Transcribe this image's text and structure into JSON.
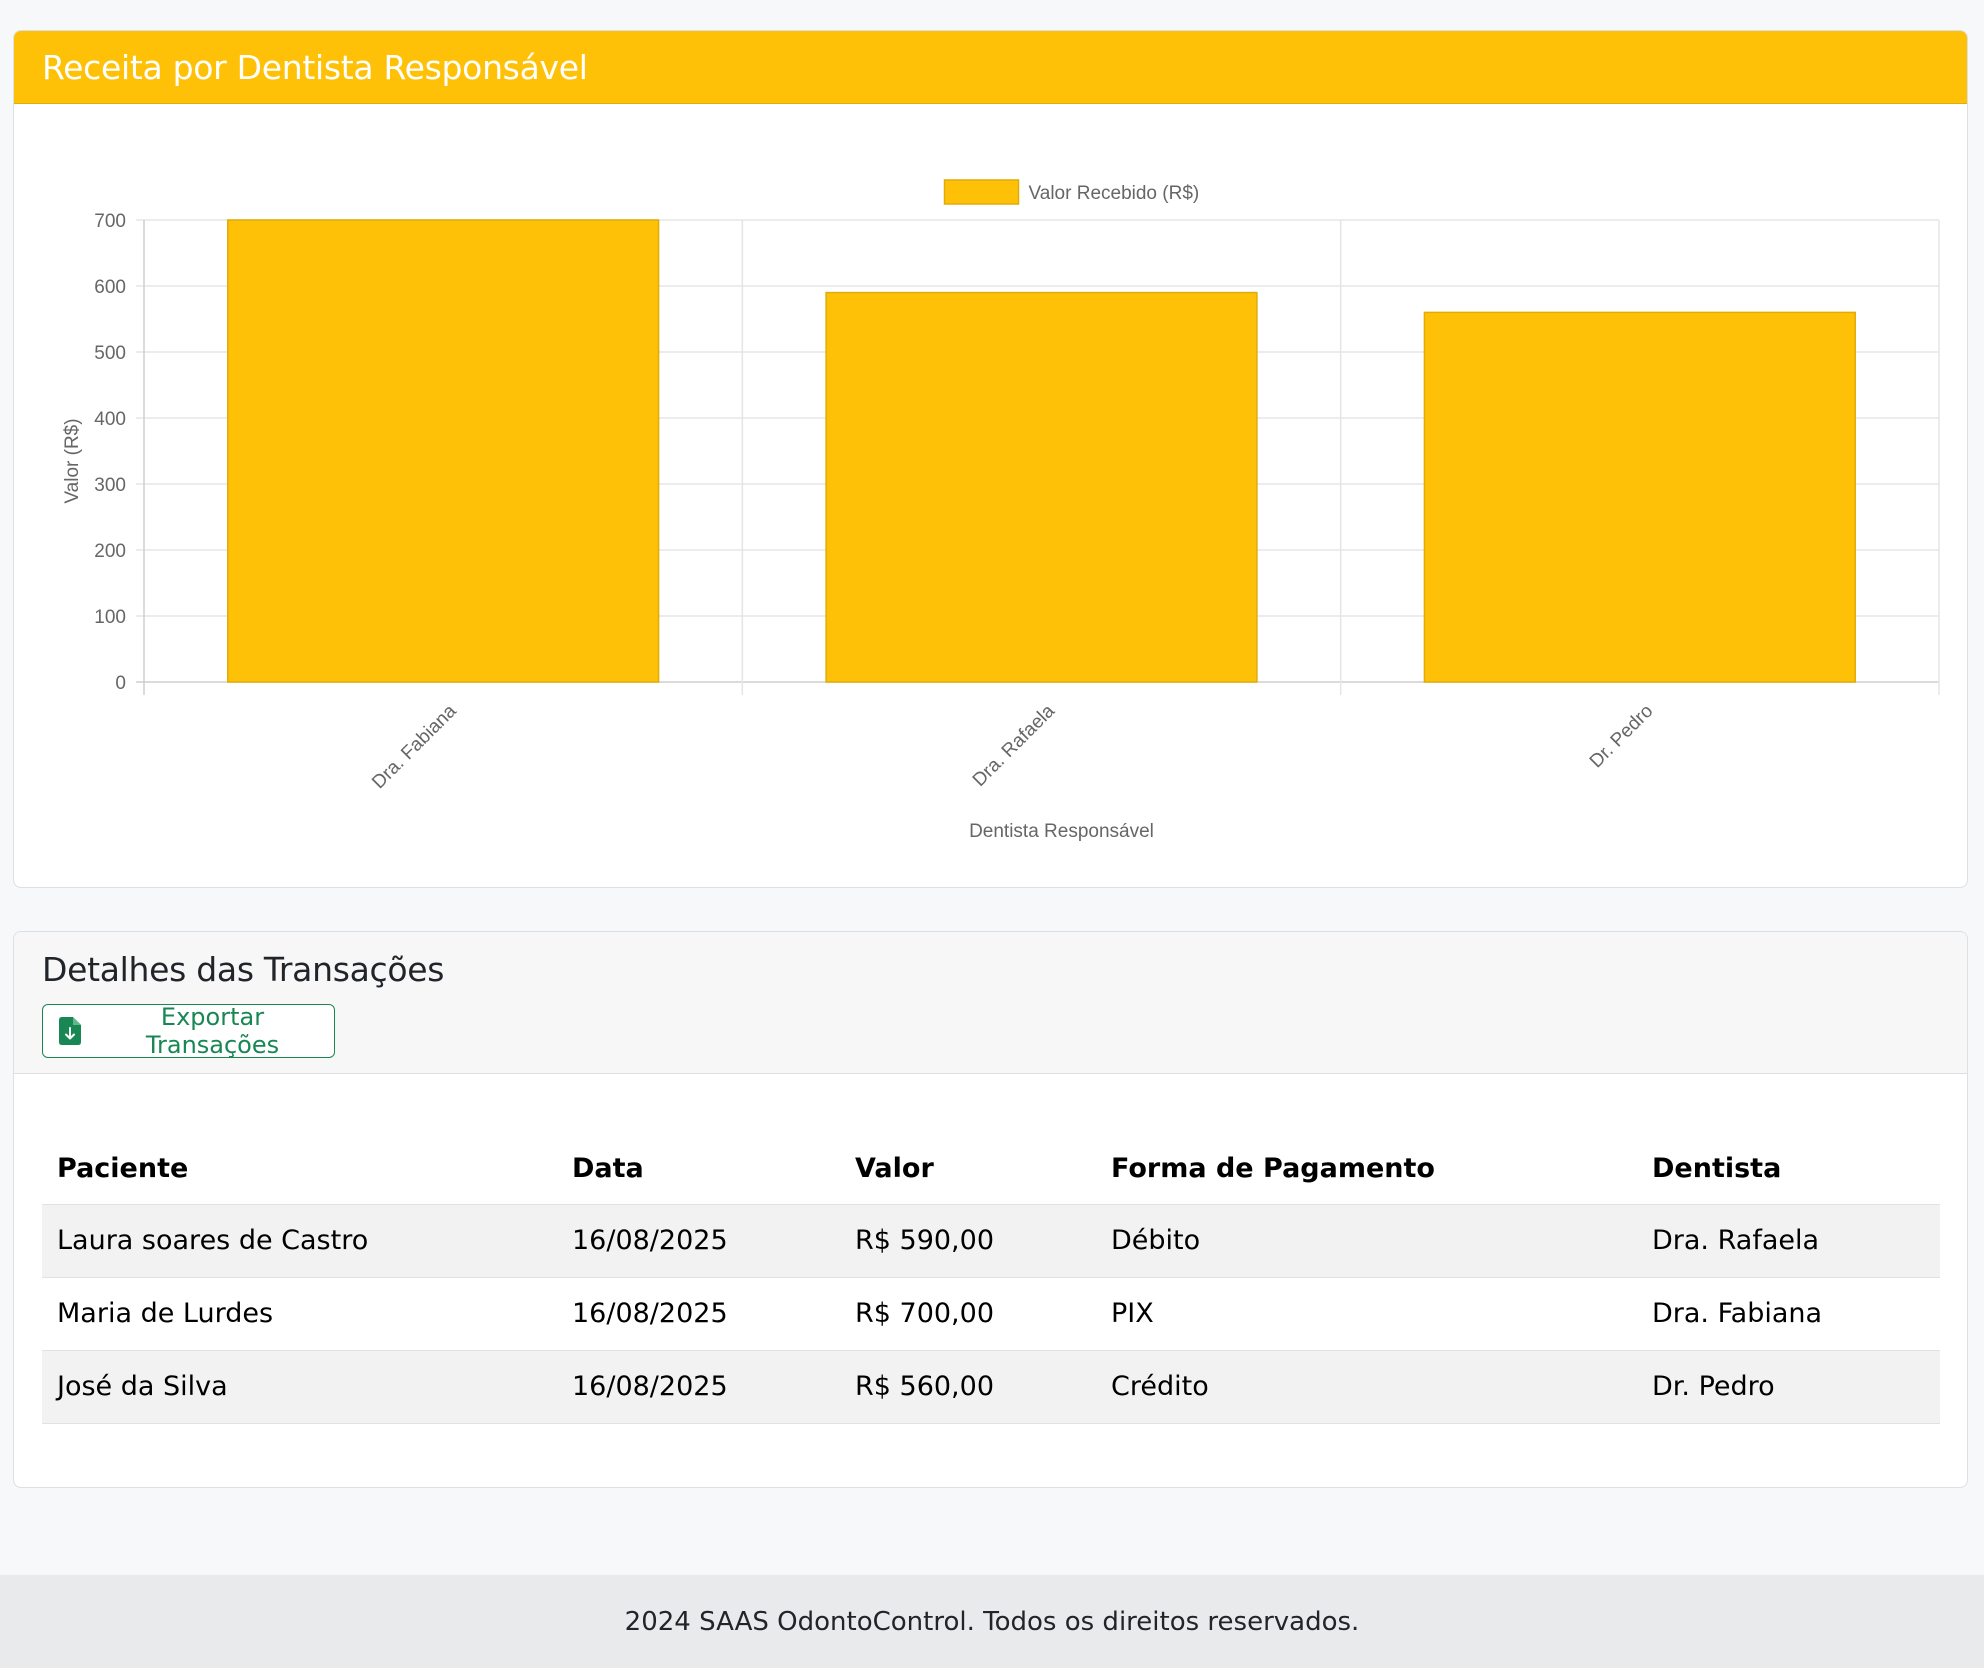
{
  "chart_card": {
    "title": "Receita por Dentista Responsável"
  },
  "chart_data": {
    "type": "bar",
    "categories": [
      "Dra. Fabiana",
      "Dra. Rafaela",
      "Dr. Pedro"
    ],
    "series": [
      {
        "name": "Valor Recebido (R$)",
        "values": [
          700,
          590,
          560
        ]
      }
    ],
    "xlabel": "Dentista Responsável",
    "ylabel": "Valor (R$)",
    "ylim": [
      0,
      700
    ],
    "yticks": [
      0,
      100,
      200,
      300,
      400,
      500,
      600,
      700
    ],
    "grid": true,
    "legend": "top-center",
    "colors": {
      "bar_fill": "#ffc107",
      "bar_border": "#e0ac08",
      "grid": "#e5e5e5"
    }
  },
  "transactions": {
    "title": "Detalhes das Transações",
    "export_label": "Exportar Transações",
    "export_icon": "file-download-icon",
    "columns": [
      "Paciente",
      "Data",
      "Valor",
      "Forma de Pagamento",
      "Dentista"
    ],
    "rows": [
      [
        "Laura soares de Castro",
        "16/08/2025",
        "R$ 590,00",
        "Débito",
        "Dra. Rafaela"
      ],
      [
        "Maria de Lurdes",
        "16/08/2025",
        "R$ 700,00",
        "PIX",
        "Dra. Fabiana"
      ],
      [
        "José da Silva",
        "16/08/2025",
        "R$ 560,00",
        "Crédito",
        "Dr. Pedro"
      ]
    ]
  },
  "footer": {
    "text": "2024 SAAS OdontoControl. Todos os direitos reservados."
  },
  "colors": {
    "accent": "#ffc107",
    "success": "#198754",
    "page_bg": "#f7f8fa"
  }
}
